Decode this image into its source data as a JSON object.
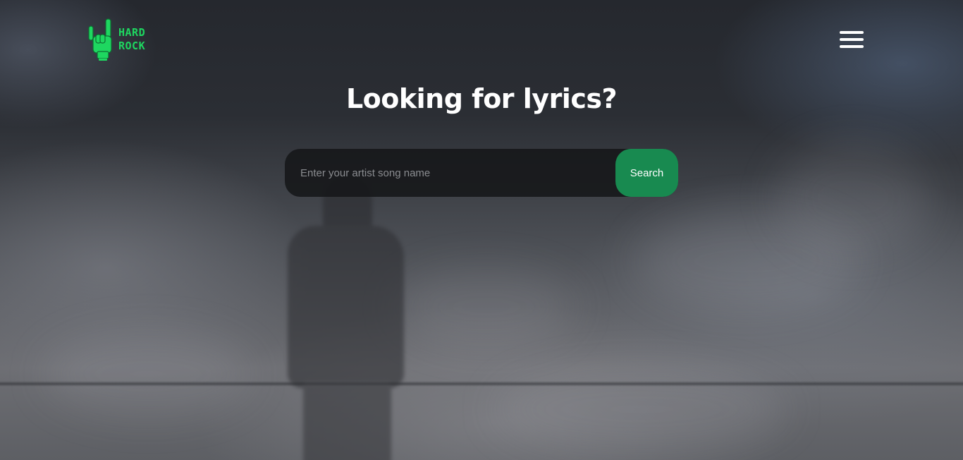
{
  "brand": {
    "line1": "HARD",
    "line2": "ROCK",
    "accent_color": "#1ed760",
    "logo_icon": "rock-hand-icon"
  },
  "header": {
    "menu_icon": "hamburger-menu-icon"
  },
  "hero": {
    "title": "Looking for lyrics?"
  },
  "search": {
    "placeholder": "Enter your artist song name",
    "value": "",
    "button_label": "Search",
    "button_color": "#188a50"
  }
}
